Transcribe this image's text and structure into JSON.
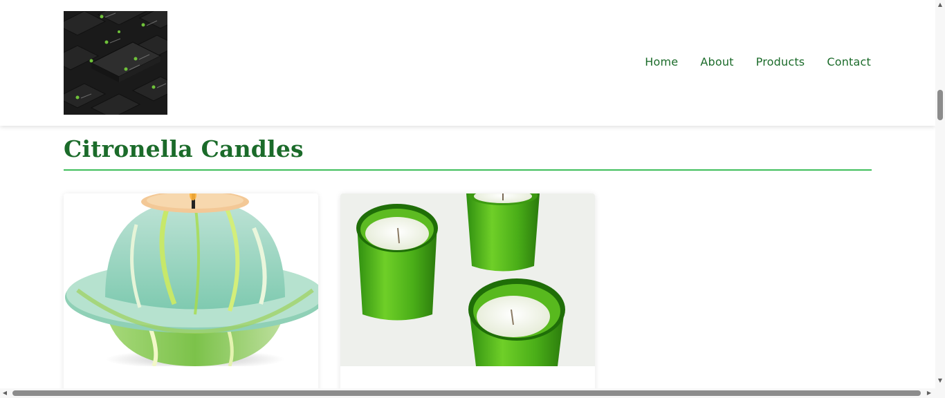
{
  "header": {
    "logo_alt": "Logo",
    "nav": {
      "home": "Home",
      "about": "About",
      "products": "Products",
      "contact": "Contact"
    }
  },
  "section": {
    "title": "Citronella Candles"
  },
  "products": [
    {
      "image": "green-marbled-saturn-candle"
    },
    {
      "image": "green-glass-votive-candles"
    }
  ],
  "colors": {
    "brand_green": "#1b6b2a",
    "rule_green": "#3fbf5b"
  },
  "scrollbars": {
    "up_arrow_icon": "triangle-up",
    "down_arrow_icon": "triangle-down",
    "left_arrow_icon": "triangle-left",
    "right_arrow_icon": "triangle-right"
  }
}
